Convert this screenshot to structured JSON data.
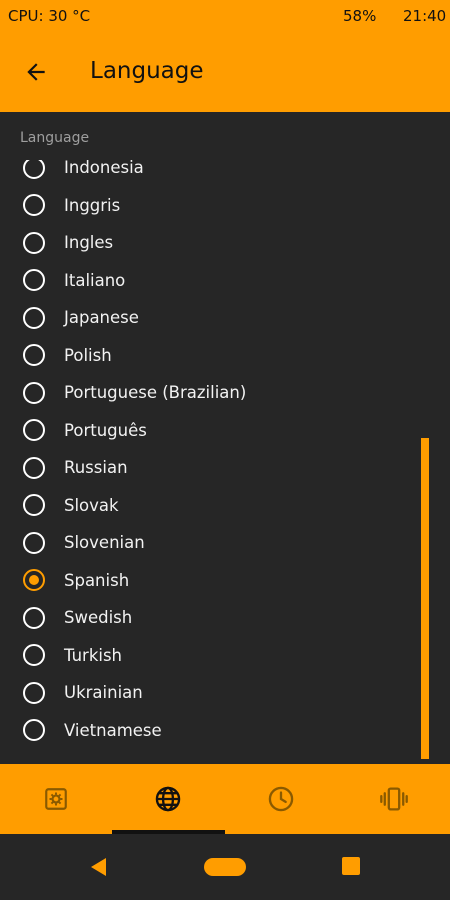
{
  "status_bar": {
    "cpu": "CPU: 30 °C",
    "battery": "58%",
    "time": "21:40"
  },
  "app_bar": {
    "title": "Language",
    "back_icon": "arrow-left-icon"
  },
  "section": {
    "header": "Language"
  },
  "languages": [
    {
      "label": "Indonesia",
      "checked": false
    },
    {
      "label": "Inggris",
      "checked": false
    },
    {
      "label": "Ingles",
      "checked": false
    },
    {
      "label": "Italiano",
      "checked": false
    },
    {
      "label": "Japanese",
      "checked": false
    },
    {
      "label": "Polish",
      "checked": false
    },
    {
      "label": "Portuguese (Brazilian)",
      "checked": false
    },
    {
      "label": "Português",
      "checked": false
    },
    {
      "label": "Russian",
      "checked": false
    },
    {
      "label": "Slovak",
      "checked": false
    },
    {
      "label": "Slovenian",
      "checked": false
    },
    {
      "label": "Spanish",
      "checked": true
    },
    {
      "label": "Swedish",
      "checked": false
    },
    {
      "label": "Turkish",
      "checked": false
    },
    {
      "label": "Ukrainian",
      "checked": false
    },
    {
      "label": "Vietnamese",
      "checked": false
    }
  ],
  "bottom_nav": {
    "items": [
      {
        "icon": "settings-gear-icon",
        "active": false
      },
      {
        "icon": "globe-icon",
        "active": true
      },
      {
        "icon": "clock-icon",
        "active": false
      },
      {
        "icon": "vibration-icon",
        "active": false
      }
    ]
  },
  "colors": {
    "accent": "#FF9D00",
    "background": "#262626",
    "text": "#F2F2F2",
    "muted": "#9E9E9E"
  }
}
